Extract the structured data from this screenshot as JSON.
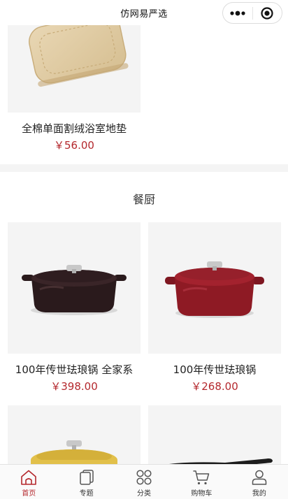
{
  "navbar": {
    "title": "仿网易严选"
  },
  "top_product": {
    "name": "全棉单面割绒浴室地垫",
    "price": "￥56.00"
  },
  "section": {
    "title": "餐厨"
  },
  "products": [
    {
      "name": "100年传世珐琅锅 全家系",
      "price": "￥398.00",
      "color": "#2a1a1c"
    },
    {
      "name": "100年传世珐琅锅",
      "price": "￥268.00",
      "color": "#8e1a24"
    },
    {
      "name": "",
      "price": "",
      "color": "#e2c04a"
    },
    {
      "name": "",
      "price": "",
      "color": "#1c1c1c"
    }
  ],
  "tabbar": {
    "items": [
      {
        "label": "首页",
        "icon": "home-icon",
        "active": true
      },
      {
        "label": "专题",
        "icon": "topic-icon",
        "active": false
      },
      {
        "label": "分类",
        "icon": "category-icon",
        "active": false
      },
      {
        "label": "购物车",
        "icon": "cart-icon",
        "active": false
      },
      {
        "label": "我的",
        "icon": "profile-icon",
        "active": false
      }
    ],
    "active_color": "#b4282d"
  }
}
